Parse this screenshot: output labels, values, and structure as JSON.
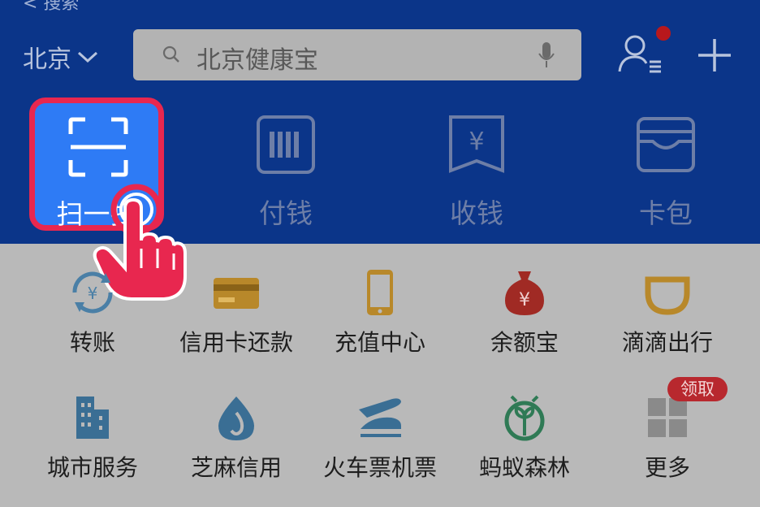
{
  "header": {
    "back_label": "< 搜索",
    "city": "北京",
    "search_text": "北京健康宝",
    "colors": {
      "bar": "#0b3589",
      "scan_highlight": "#2e7bf5",
      "focus_ring": "#e8274f"
    }
  },
  "quick_actions": [
    {
      "label": "扫一扫",
      "icon": "scan-icon"
    },
    {
      "label": "付钱",
      "icon": "barcode-icon"
    },
    {
      "label": "收钱",
      "icon": "yuan-receipt-icon"
    },
    {
      "label": "卡包",
      "icon": "wallet-icon"
    }
  ],
  "grid": [
    {
      "label": "转账",
      "icon": "transfer-icon"
    },
    {
      "label": "信用卡还款",
      "icon": "credit-card-icon"
    },
    {
      "label": "充值中心",
      "icon": "phone-recharge-icon"
    },
    {
      "label": "余额宝",
      "icon": "money-bag-icon"
    },
    {
      "label": "滴滴出行",
      "icon": "didi-icon"
    },
    {
      "label": "城市服务",
      "icon": "city-building-icon"
    },
    {
      "label": "芝麻信用",
      "icon": "sesame-credit-icon"
    },
    {
      "label": "火车票机票",
      "icon": "train-plane-icon"
    },
    {
      "label": "蚂蚁森林",
      "icon": "sprout-icon"
    },
    {
      "label": "更多",
      "icon": "more-grid-icon"
    }
  ],
  "more_badge": "领取"
}
